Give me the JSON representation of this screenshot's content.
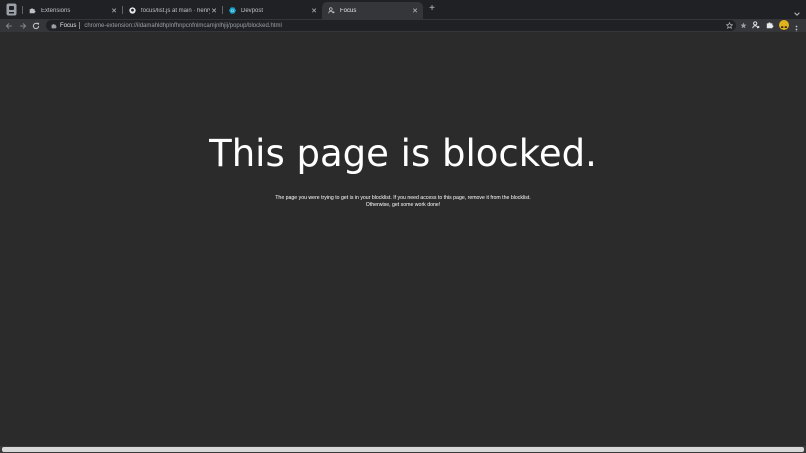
{
  "tabs": [
    {
      "title": "Extensions",
      "icon": "puzzle-icon",
      "active": false
    },
    {
      "title": "focus/list.js at main · henry-lo",
      "icon": "github-icon",
      "active": false
    },
    {
      "title": "Devpost",
      "icon": "devpost-icon",
      "active": false
    },
    {
      "title": "Focus",
      "icon": "focus-icon",
      "active": true
    }
  ],
  "toolbar": {
    "origin": "Focus",
    "url": "chrome-extension://ildamahldhplnfhnpcnfnlmcamjnlhjij/popup/blocked.html"
  },
  "page": {
    "heading": "This page is blocked.",
    "message_line1": "The page you were trying to get is in your blocklist. If you need access to this page, remove it from the blocklist.",
    "message_line2": "Otherwise, get some work done!"
  },
  "colors": {
    "tabstrip": "#202124",
    "toolbar": "#35363a",
    "content_bg": "#2b2b2b",
    "avatar": "#e0b21c"
  }
}
